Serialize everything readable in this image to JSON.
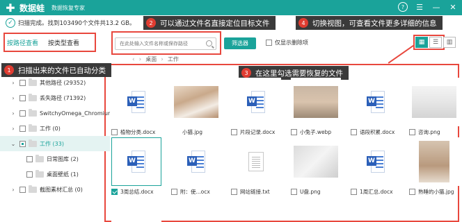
{
  "app": {
    "name": "数据蛙",
    "subtitle": "数据恢复专家",
    "logo_icon": "plus-icon",
    "controls": [
      "help-icon",
      "menu-icon",
      "minimize-icon",
      "close-icon"
    ]
  },
  "status": {
    "text": "扫描完成。找到103490个文件共13.2 GB。"
  },
  "callouts": [
    {
      "num": "1",
      "text": "扫描出来的文件已自动分类"
    },
    {
      "num": "2",
      "text": "可以通过文件名直接定位目标文件"
    },
    {
      "num": "3",
      "text": "在这里勾选需要恢复的文件"
    },
    {
      "num": "4",
      "text": "切换视图，可查看文件更多详细的信息"
    }
  ],
  "view_tabs": [
    {
      "label": "按路径查看",
      "active": true
    },
    {
      "label": "按类型查看",
      "active": false
    }
  ],
  "search": {
    "placeholder": "在此处输入文件名称或保存路径"
  },
  "filter_label": "筛选器",
  "deleted_only_label": "仅显示删除项",
  "view_modes": [
    {
      "icon": "grid-icon",
      "active": true
    },
    {
      "icon": "list-icon",
      "active": false
    },
    {
      "icon": "detail-icon",
      "active": false
    }
  ],
  "breadcrumb": [
    "桌面",
    "工作"
  ],
  "tree": [
    {
      "name": "其他路径 (29352)",
      "indent": 1,
      "expanded": false,
      "checked": false,
      "selected": false
    },
    {
      "name": "丢失路径 (71392)",
      "indent": 1,
      "expanded": false,
      "checked": false,
      "selected": false
    },
    {
      "name": "SwitchyOmega_Chromium",
      "indent": 1,
      "expanded": false,
      "checked": false,
      "selected": false
    },
    {
      "name": "工作 (0)",
      "indent": 1,
      "expanded": false,
      "checked": false,
      "selected": false
    },
    {
      "name": "工作 (33)",
      "indent": 1,
      "expanded": true,
      "checked": "partial",
      "selected": true
    },
    {
      "name": "日常图库 (2)",
      "indent": 2,
      "expanded": false,
      "checked": false,
      "selected": false
    },
    {
      "name": "桌面壁纸 (1)",
      "indent": 2,
      "expanded": false,
      "checked": false,
      "selected": false
    },
    {
      "name": "截图素材汇总 (0)",
      "indent": 1,
      "expanded": false,
      "checked": false,
      "selected": false
    }
  ],
  "files": [
    {
      "name": "植物分类.docx",
      "type": "word",
      "checked": false
    },
    {
      "name": "小猫.jpg",
      "type": "kitten",
      "checked": false
    },
    {
      "name": "片段记录.docx",
      "type": "word",
      "checked": false
    },
    {
      "name": "小兔子.webp",
      "type": "bunny",
      "checked": false
    },
    {
      "name": "语段积累.docx",
      "type": "word",
      "checked": false
    },
    {
      "name": "咨询.png",
      "type": "office",
      "checked": false
    },
    {
      "name": "3周总结.docx",
      "type": "word",
      "checked": true,
      "selected": true
    },
    {
      "name": "附：使...ocx",
      "type": "word",
      "checked": false
    },
    {
      "name": "网站链接.txt",
      "type": "txt",
      "checked": false
    },
    {
      "name": "U盘.png",
      "type": "usb",
      "checked": false
    },
    {
      "name": "1周汇总.docx",
      "type": "word",
      "checked": false
    },
    {
      "name": "熟睡的小猫.jpg",
      "type": "cat2",
      "checked": false
    }
  ],
  "colors": {
    "accent": "#1aa39a",
    "annotation_red": "#e8473d",
    "callout_bg": "#3a3a3a"
  }
}
